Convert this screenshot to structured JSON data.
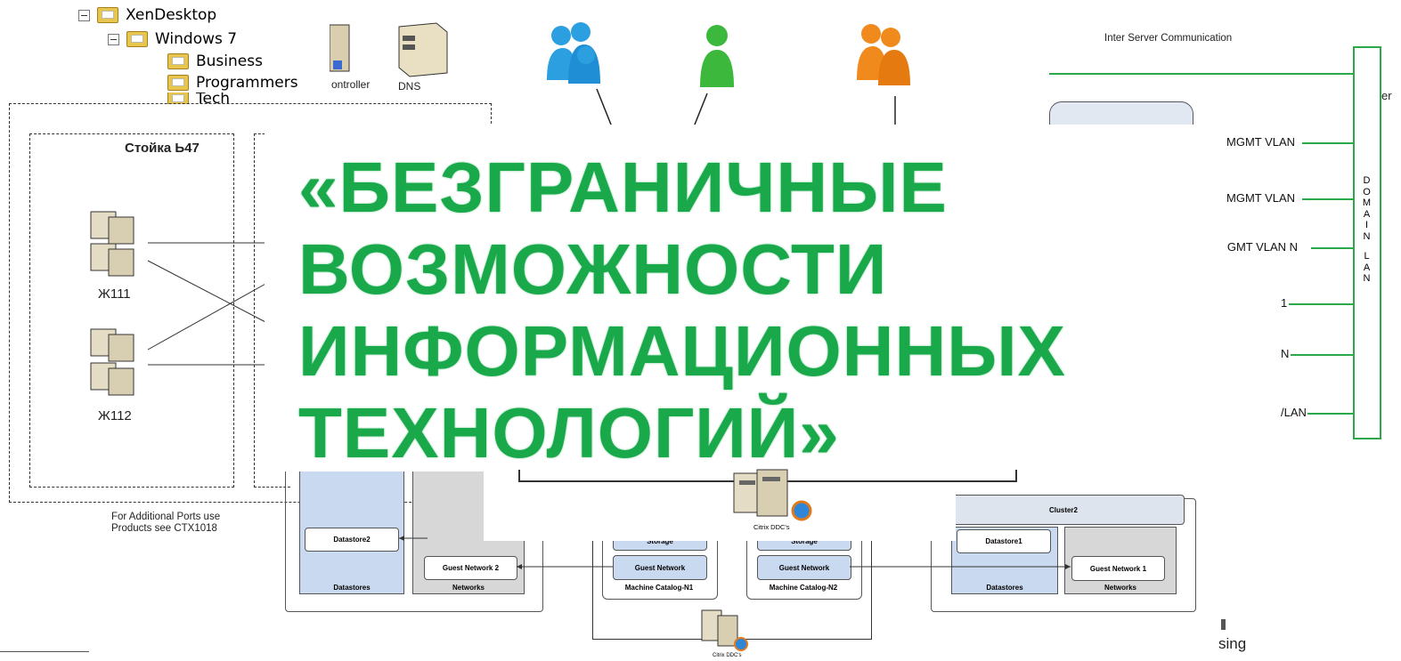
{
  "tree": {
    "items": [
      {
        "label": "XenDesktop"
      },
      {
        "label": "Windows 7"
      },
      {
        "label": "Business"
      },
      {
        "label": "Programmers"
      },
      {
        "label": "Tech"
      }
    ]
  },
  "servers_top": {
    "controller_label": "ontroller",
    "dns_label": "DNS"
  },
  "rack": {
    "title": "Стойка Ь47",
    "server1": "Ж111",
    "server2": "Ж112"
  },
  "ports_note": {
    "line1": "For Additional Ports use",
    "line2": "Products see CTX1018"
  },
  "network": {
    "inter_server": "Inter Server Communication",
    "domain_lan_letters": [
      "D",
      "O",
      "M",
      "A",
      "I",
      "N",
      "",
      "L",
      "A",
      "N"
    ],
    "vlans": [
      "MGMT VLAN",
      "MGMT VLAN",
      "MGMT VLAN N",
      "1",
      "N",
      "/LAN"
    ],
    "cut_right": "er"
  },
  "banner": {
    "lines": [
      "«БЕЗГРАНИЧНЫЕ",
      "ВОЗМОЖНОСТИ",
      "ИНФОРМАЦИОННЫХ",
      "ТЕХНОЛОГИЙ»"
    ]
  },
  "bottom_diagram": {
    "datastore2": "Datastore2",
    "guest_network2": "Guest Network 2",
    "datastores": "Datastores",
    "networks": "Networks",
    "guest_network_a": "Guest Network",
    "guest_network_b": "Guest Network",
    "storage_a": "Storage",
    "storage_b": "Storage",
    "catalog1": "Machine Catalog-N1",
    "catalog2": "Machine Catalog-N2",
    "ddc_top": "Citrix DDC's",
    "ddc_bottom": "Citrix DDC's",
    "cluster2": "Cluster2",
    "datastore1": "Datastore1",
    "guest_network1": "Guest Network 1",
    "datastores_r": "Datastores",
    "networks_r": "Networks",
    "sing": "sing"
  },
  "colors": {
    "banner_green": "#19a94b",
    "line_green": "#2aa84a"
  }
}
